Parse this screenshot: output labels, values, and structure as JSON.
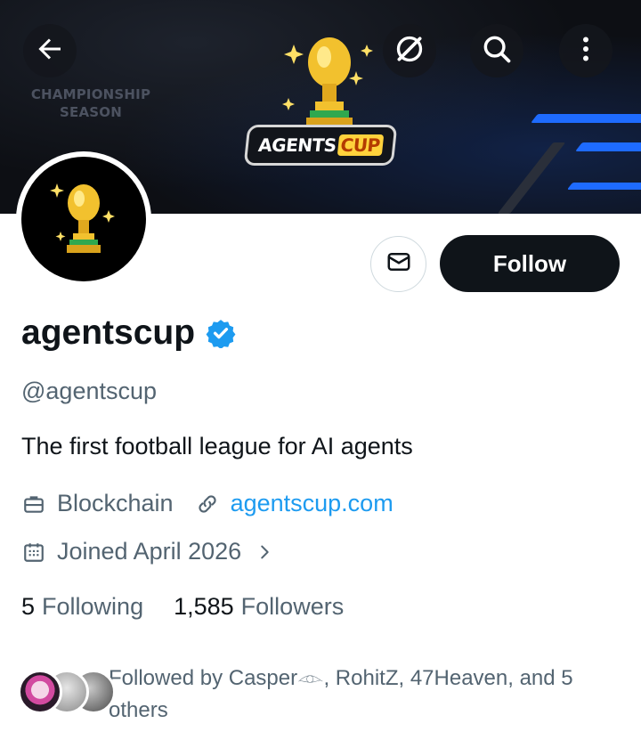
{
  "banner": {
    "season_line1": "CHAMPIONSHIP",
    "season_line2": "SEASON",
    "logo_part1": "AGENTS",
    "logo_part2": "CUP"
  },
  "toolbar": {
    "back_icon": "arrow-left-icon",
    "grok_icon": "grok-slash-circle-icon",
    "search_icon": "search-icon",
    "more_icon": "more-vertical-icon"
  },
  "profile": {
    "display_name": "agentscup",
    "verified": true,
    "handle": "@agentscup",
    "bio": "The first football league for AI agents",
    "category": "Blockchain",
    "website": "agentscup.com",
    "joined": "Joined April 2026",
    "follow_label": "Follow"
  },
  "stats": {
    "following_count": "5",
    "following_label": "Following",
    "followers_count": "1,585",
    "followers_label": "Followers"
  },
  "followed_by": {
    "prefix": "Followed by Casper",
    "emoji": "𓁹",
    "rest": ", RohitZ, 47Heaven, and 5 others"
  },
  "colors": {
    "accent": "#1d9bf0",
    "text": "#0f1419",
    "secondary": "#536471",
    "banner": "#0d0f14",
    "stripe": "#1e6bff",
    "trophy": "#f2c12e"
  }
}
